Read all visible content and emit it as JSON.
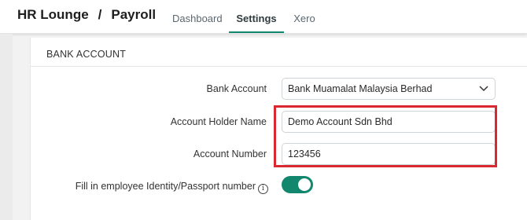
{
  "header": {
    "app_name": "HR Lounge",
    "separator": "/",
    "module": "Payroll",
    "tabs": [
      {
        "label": "Dashboard",
        "active": false
      },
      {
        "label": "Settings",
        "active": true
      },
      {
        "label": "Xero",
        "active": false
      }
    ],
    "accent_color": "#13876e"
  },
  "section": {
    "title": "BANK ACCOUNT"
  },
  "form": {
    "bank_account": {
      "label": "Bank Account",
      "value": "Bank Muamalat Malaysia Berhad",
      "icon": "chevron-down-icon"
    },
    "account_holder_name": {
      "label": "Account Holder Name",
      "value": "Demo Account Sdn Bhd"
    },
    "account_number": {
      "label": "Account Number",
      "value": "123456"
    },
    "fill_identity": {
      "label": "Fill in employee Identity/Passport number",
      "info_icon": "info-icon",
      "info_glyph": "i",
      "enabled": true
    }
  },
  "highlight_color": "#d9282f"
}
